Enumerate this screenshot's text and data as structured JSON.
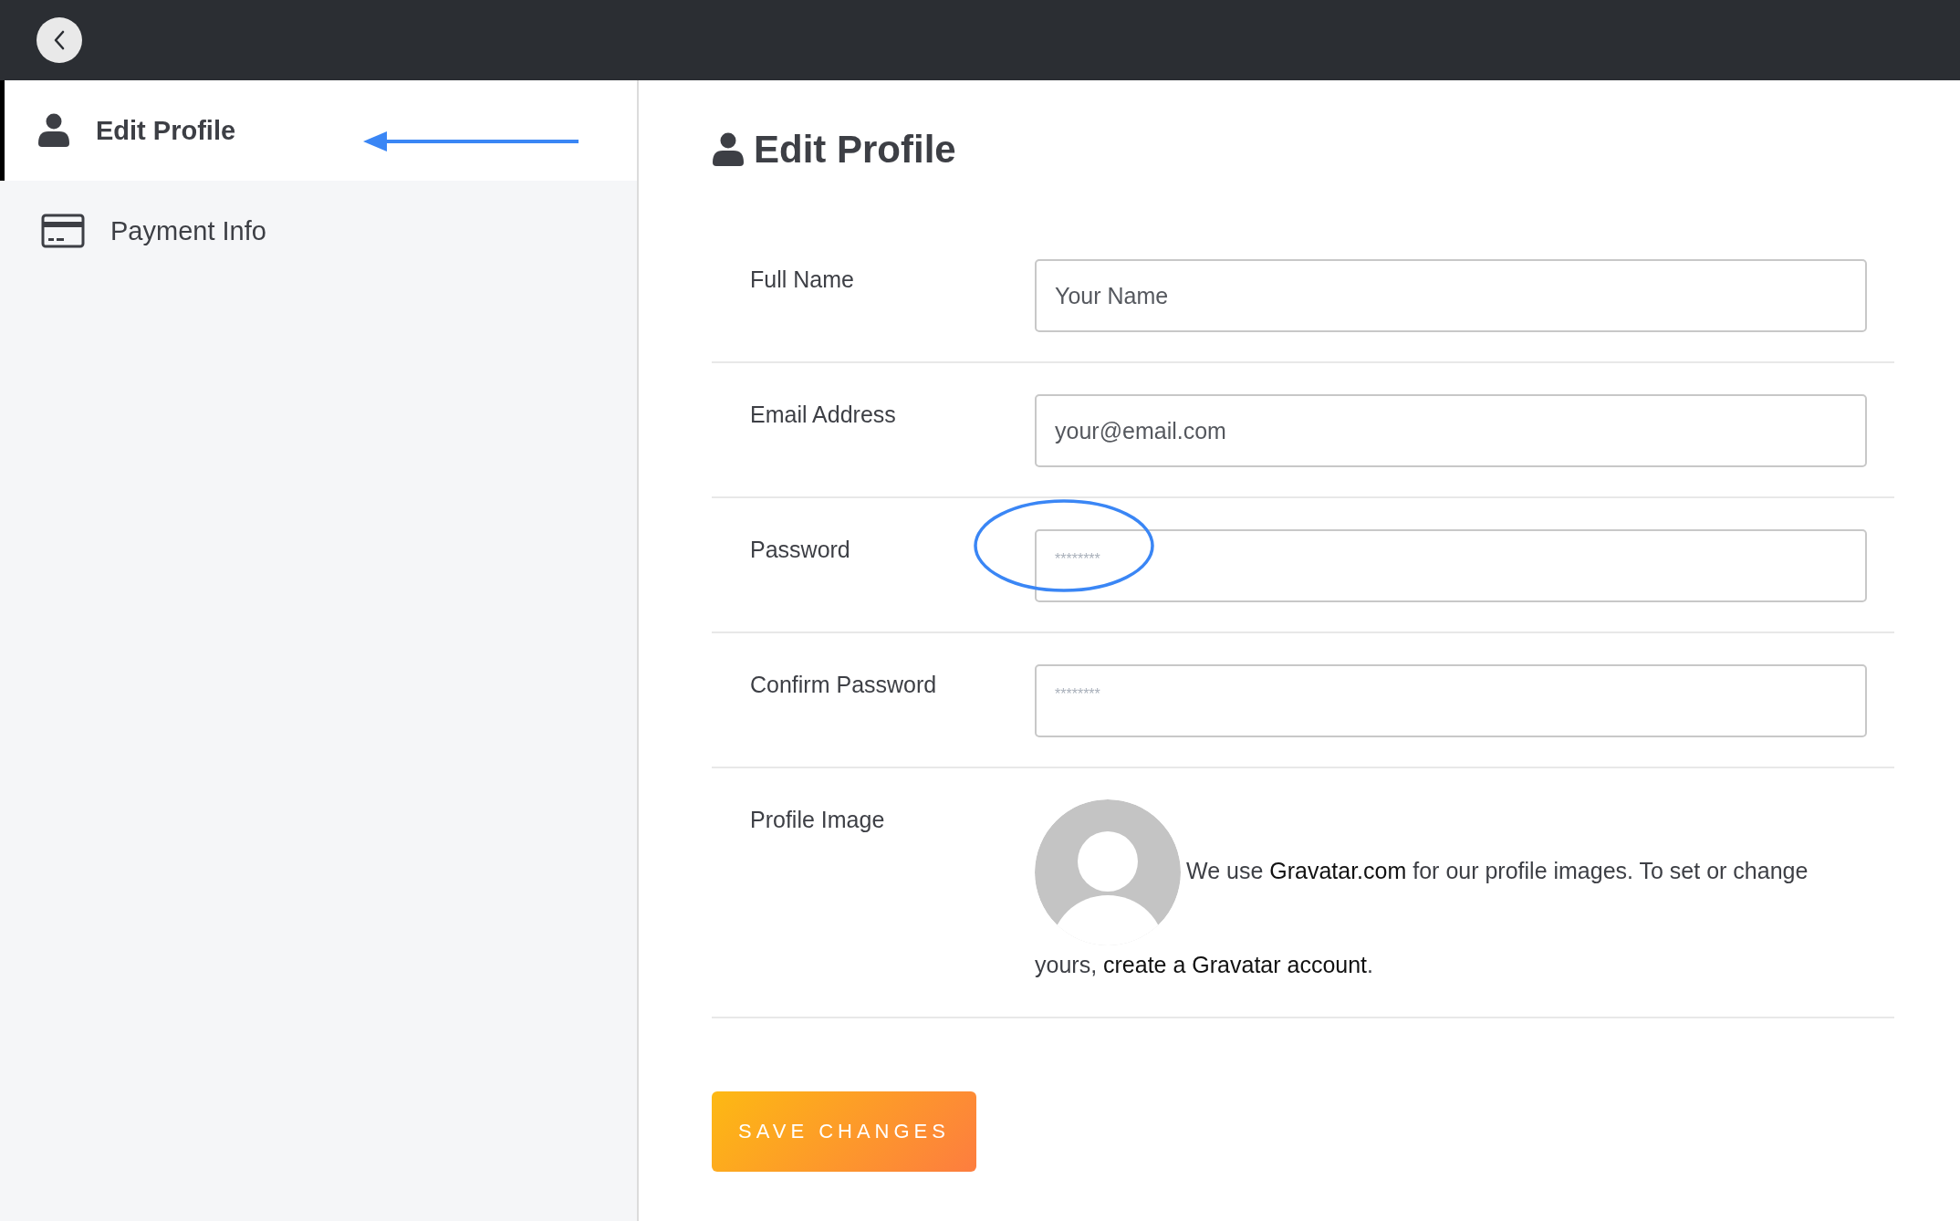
{
  "sidebar": {
    "items": [
      {
        "label": "Edit Profile",
        "kind": "user",
        "selected": true
      },
      {
        "label": "Payment Info",
        "kind": "card",
        "selected": false
      }
    ]
  },
  "page": {
    "title": "Edit Profile"
  },
  "form": {
    "fields": [
      {
        "label": "Full Name",
        "kind": "text",
        "placeholder": "Your Name"
      },
      {
        "label": "Email Address",
        "kind": "email",
        "placeholder": "your@email.com"
      },
      {
        "label": "Password",
        "kind": "password",
        "placeholder": "********"
      },
      {
        "label": "Confirm Password",
        "kind": "password",
        "placeholder": "********"
      }
    ],
    "profile_image": {
      "label": "Profile Image",
      "text_before": "We use",
      "link_1": "Gravatar.com",
      "text_middle": "for our profile images. To set or change yours,",
      "link_2": "create a Gravatar account",
      "text_after": "."
    }
  },
  "save_button": "SAVE CHANGES"
}
